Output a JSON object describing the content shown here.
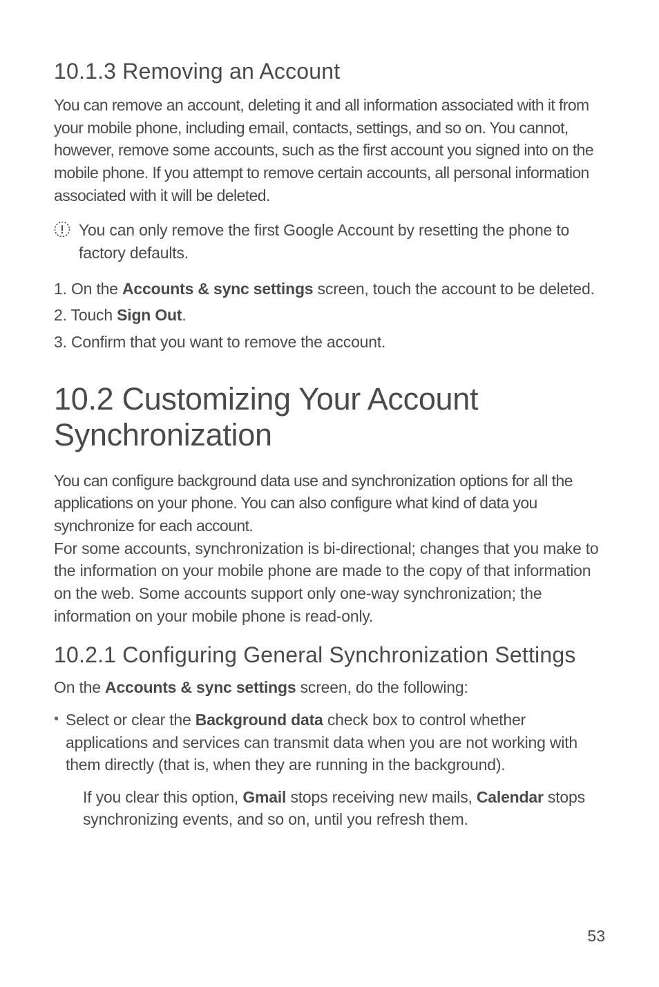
{
  "section_10_1_3": {
    "heading": "10.1.3  Removing an Account",
    "paragraph": "You can remove an account, deleting it and all information associated with it from your mobile phone, including email, contacts, settings, and so on. You cannot, however, remove some accounts, such as the first account you signed into on the mobile phone. If you attempt to remove certain accounts, all personal information associated with it will be deleted.",
    "note": "You can only remove the first Google Account by resetting the phone to factory defaults.",
    "step1_pre": "1. On the ",
    "step1_bold": "Accounts & sync settings",
    "step1_post": " screen, touch the account to be deleted.",
    "step2_pre": "2. Touch ",
    "step2_bold": "Sign Out",
    "step2_post": ".",
    "step3": "3. Confirm that you want to remove the account."
  },
  "section_10_2": {
    "heading": "10.2  Customizing Your Account Synchronization",
    "para1": "You can configure background data use and synchronization options for all the applications on your phone. You can also configure what kind of data you synchronize for each account.",
    "para2": "For some accounts, synchronization is bi-directional; changes that you make to the information on your mobile phone are made to the copy of that information on the web. Some accounts support only one-way synchronization; the information on your mobile phone is read-only."
  },
  "section_10_2_1": {
    "heading": "10.2.1  Configuring General Synchronization Settings",
    "intro_pre": "On the ",
    "intro_bold": "Accounts & sync settings",
    "intro_post": " screen, do the following:",
    "bullet_pre": "Select or clear the ",
    "bullet_bold": "Background data",
    "bullet_post": " check box to control whether applications and services can transmit data when you are not working with them directly (that is, when they are running in the background).",
    "indent_pre": "If you clear this option, ",
    "indent_bold1": "Gmail",
    "indent_mid": " stops receiving new mails, ",
    "indent_bold2": "Calendar",
    "indent_post": " stops synchronizing events, and so on, until you refresh them."
  },
  "page_number": "53"
}
